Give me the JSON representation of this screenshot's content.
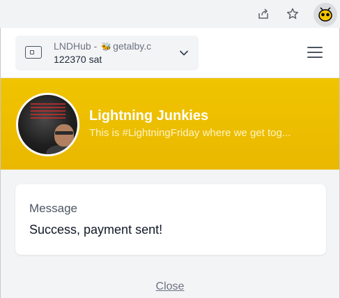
{
  "browser": {
    "icons": [
      "share-icon",
      "star-icon",
      "extension-icon"
    ]
  },
  "account": {
    "name_prefix": "LNDHub - ",
    "name_suffix": "getalby.c",
    "balance": "122370 sat"
  },
  "site": {
    "title": "Lightning Junkies",
    "description": "This is #LightningFriday where we get tog..."
  },
  "message": {
    "label": "Message",
    "text": "Success, payment sent!"
  },
  "actions": {
    "close_label": "Close"
  },
  "colors": {
    "banner": "#f0c400",
    "background": "#f3f4f6"
  }
}
